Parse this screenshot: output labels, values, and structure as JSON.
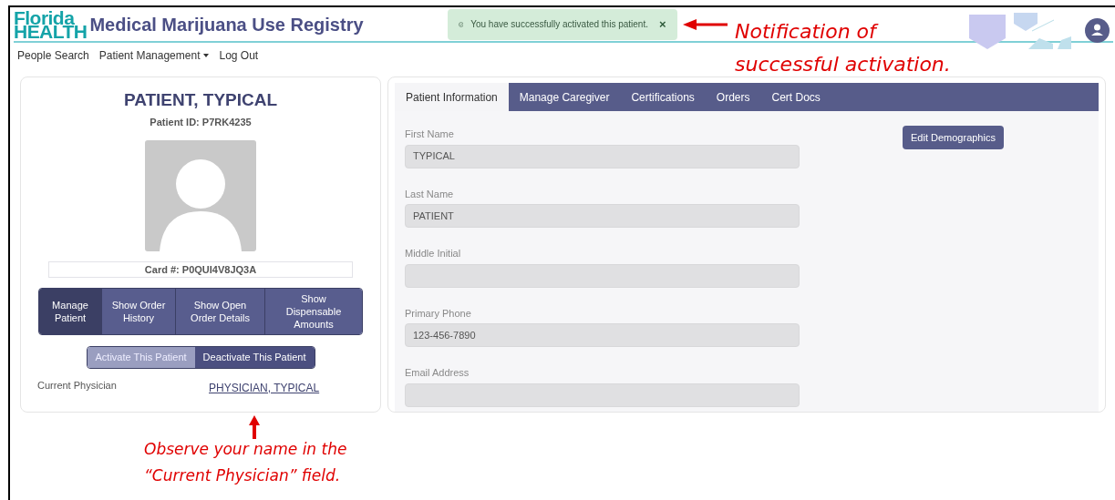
{
  "header": {
    "logo": [
      "Florida",
      "HEALTH"
    ],
    "title": "Medical Marijuana Use Registry",
    "notification": {
      "message": "You have successfully activated this patient.",
      "close": "×"
    }
  },
  "nav": [
    {
      "label": "People Search",
      "kind": "link"
    },
    {
      "label": "Patient Management",
      "kind": "dropdown"
    },
    {
      "label": "Log Out",
      "kind": "link"
    }
  ],
  "patient": {
    "name": "PATIENT, TYPICAL",
    "patient_id": "Patient ID: P7RK4235",
    "card": "Card #: P0QUI4V8JQ3A",
    "actions": [
      {
        "label": "Manage Patient",
        "selected": true
      },
      {
        "label": "Show Order History",
        "selected": false
      },
      {
        "label": "Show Open Order Details",
        "selected": false
      },
      {
        "label": "Show Dispensable Amounts",
        "selected": false
      }
    ],
    "status_buttons": [
      {
        "label": "Activate This Patient",
        "disabled": true
      },
      {
        "label": "Deactivate This Patient",
        "disabled": false
      }
    ],
    "physician_label": "Current Physician",
    "physician": "PHYSICIAN, TYPICAL"
  },
  "tabs": [
    {
      "label": "Patient Information",
      "selected": true
    },
    {
      "label": "Manage Caregiver",
      "selected": false
    },
    {
      "label": "Certifications",
      "selected": false
    },
    {
      "label": "Orders",
      "selected": false
    },
    {
      "label": "Cert Docs",
      "selected": false
    }
  ],
  "form": {
    "fields": [
      {
        "label": "First Name",
        "value": "TYPICAL"
      },
      {
        "label": "Last Name",
        "value": "PATIENT"
      },
      {
        "label": "Middle Initial"
      },
      {
        "label": "Primary Phone",
        "value": "123-456-7890"
      },
      {
        "label": "Email Address"
      }
    ],
    "edit_button": "Edit Demographics"
  },
  "annotations": [
    {
      "kind": "notification",
      "lines": [
        "Notification of",
        "successful activation."
      ]
    },
    {
      "kind": "physician",
      "lines": [
        "Observe your name in the",
        "“Current Physician” field."
      ]
    }
  ]
}
